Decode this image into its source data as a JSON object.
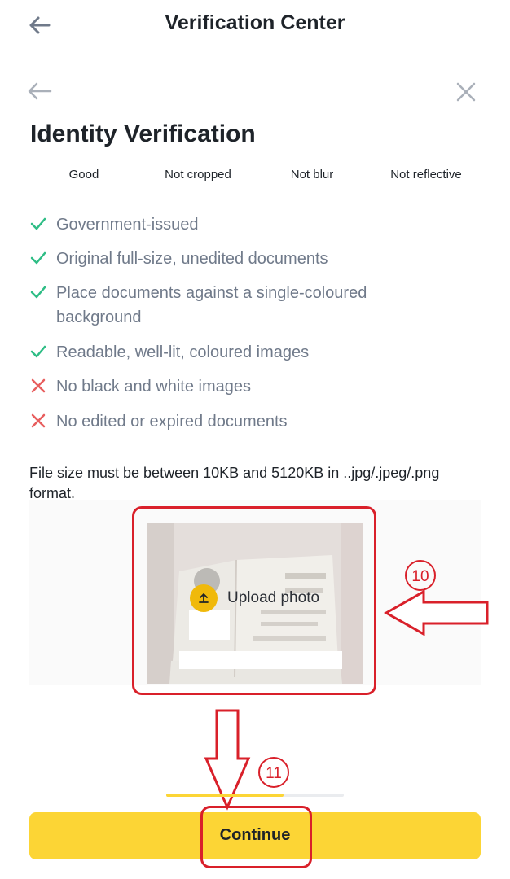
{
  "header": {
    "title": "Verification Center"
  },
  "page": {
    "title": "Identity Verification"
  },
  "tips": [
    "Good",
    "Not cropped",
    "Not blur",
    "Not reflective"
  ],
  "requirements": [
    {
      "text": "Government-issued",
      "ok": true
    },
    {
      "text": "Original full-size, unedited documents",
      "ok": true
    },
    {
      "text": "Place documents against a single-coloured background",
      "ok": true
    },
    {
      "text": "Readable, well-lit, coloured images",
      "ok": true
    },
    {
      "text": "No black and white images",
      "ok": false
    },
    {
      "text": "No edited or expired documents",
      "ok": false
    }
  ],
  "file_note": "File size must be between 10KB and 5120KB in ..jpg/.jpeg/.png format.",
  "upload": {
    "label": "Upload photo"
  },
  "annotations": {
    "step_10": "10",
    "step_11": "11"
  },
  "progress": {
    "fraction": 0.66
  },
  "continue_label": "Continue",
  "icons": {
    "check": "check-icon",
    "cross": "cross-icon",
    "back": "arrow-left-icon",
    "close": "close-icon",
    "upload": "upload-icon"
  },
  "colors": {
    "accent": "#fcd535",
    "check": "#2ebd85",
    "cross": "#e85d5d",
    "annotation": "#d9202a"
  }
}
